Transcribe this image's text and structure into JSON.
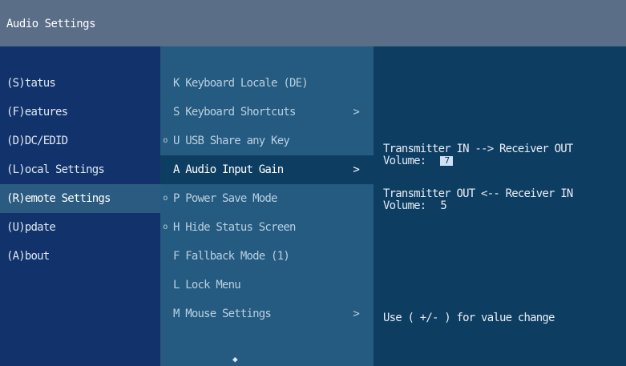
{
  "window": {
    "title": "Audio Settings"
  },
  "left_menu": [
    {
      "label": "(S)tatus",
      "active": false
    },
    {
      "label": "(F)eatures",
      "active": false
    },
    {
      "label": "(D)DC/EDID",
      "active": false
    },
    {
      "label": "(L)ocal  Settings",
      "active": false
    },
    {
      "label": "(R)emote Settings",
      "active": true
    },
    {
      "label": "(U)pdate",
      "active": false
    },
    {
      "label": "(A)bout",
      "active": false
    }
  ],
  "mid_menu": [
    {
      "label": "K Keyboard Locale (DE)",
      "bullet": "",
      "chevron": ""
    },
    {
      "label": "S Keyboard Shortcuts",
      "bullet": "",
      "chevron": ">"
    },
    {
      "label": "U USB Share any Key",
      "bullet": "o",
      "chevron": ""
    },
    {
      "label": "A Audio Input Gain",
      "bullet": "",
      "chevron": ">"
    },
    {
      "label": "P Power Save Mode",
      "bullet": "o",
      "chevron": ""
    },
    {
      "label": "H Hide Status Screen",
      "bullet": "o",
      "chevron": ""
    },
    {
      "label": "F Fallback Mode (1)",
      "bullet": "",
      "chevron": ""
    },
    {
      "label": "L Lock Menu",
      "bullet": "",
      "chevron": ""
    },
    {
      "label": "M Mouse Settings",
      "bullet": "",
      "chevron": ">"
    }
  ],
  "mid_more_indicator": "◆",
  "detail": {
    "tx_in_label": "Transmitter IN --> Receiver OUT",
    "volume_label_1": "Volume:",
    "volume_value_1": "7",
    "tx_out_label": "Transmitter OUT <-- Receiver IN",
    "volume_label_2": "Volume:",
    "volume_value_2": "5",
    "hint": "Use ( +/- ) for value change"
  },
  "colors": {
    "titlebar": "#5a6e88",
    "left_panel": "#12326b",
    "mid_panel": "#255b80",
    "right_panel": "#0e3d62",
    "highlight": "#2b5b80",
    "input_bg": "#cfe2f4"
  }
}
